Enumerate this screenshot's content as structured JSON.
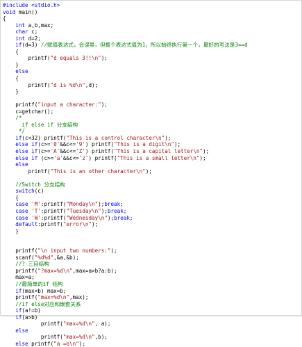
{
  "editor": {
    "lines": [
      [
        {
          "t": "#include <stdio.h>",
          "c": "pp"
        }
      ],
      [
        {
          "t": "void",
          "c": "kw"
        },
        {
          "t": " main()",
          "c": ""
        }
      ],
      [
        {
          "t": "{",
          "c": ""
        }
      ],
      [
        {
          "t": "    ",
          "c": ""
        },
        {
          "t": "int",
          "c": "kw"
        },
        {
          "t": " a,b,max;",
          "c": ""
        }
      ],
      [
        {
          "t": "    ",
          "c": ""
        },
        {
          "t": "char",
          "c": "kw"
        },
        {
          "t": " c;",
          "c": ""
        }
      ],
      [
        {
          "t": "    ",
          "c": ""
        },
        {
          "t": "int",
          "c": "kw"
        },
        {
          "t": " d=2;",
          "c": ""
        }
      ],
      [
        {
          "t": "    ",
          "c": ""
        },
        {
          "t": "if",
          "c": "kw"
        },
        {
          "t": "(d=3) ",
          "c": ""
        },
        {
          "t": "//赋值表达式，会误导，但整个表达式值为1，所以始终执行第一个，最好的写法是3==d",
          "c": "cm"
        }
      ],
      [
        {
          "t": "    {",
          "c": ""
        }
      ],
      [
        {
          "t": "        printf(",
          "c": ""
        },
        {
          "t": "\"d equals 3!!\\n\"",
          "c": "st"
        },
        {
          "t": ");",
          "c": ""
        }
      ],
      [
        {
          "t": "    }",
          "c": ""
        }
      ],
      [
        {
          "t": "    ",
          "c": ""
        },
        {
          "t": "else",
          "c": "kw"
        }
      ],
      [
        {
          "t": "    {",
          "c": ""
        }
      ],
      [
        {
          "t": "        printf(",
          "c": ""
        },
        {
          "t": "\"d is %d\\n\"",
          "c": "st"
        },
        {
          "t": ",d);",
          "c": ""
        }
      ],
      [
        {
          "t": "    }",
          "c": ""
        }
      ],
      [
        {
          "t": "",
          "c": ""
        }
      ],
      [
        {
          "t": "    printf(",
          "c": ""
        },
        {
          "t": "\"input a character:\"",
          "c": "st"
        },
        {
          "t": ");",
          "c": ""
        }
      ],
      [
        {
          "t": "    c=getchar();",
          "c": ""
        }
      ],
      [
        {
          "t": "    /*",
          "c": "cm"
        }
      ],
      [
        {
          "t": "      if else if 分支结构",
          "c": "cm"
        }
      ],
      [
        {
          "t": "     */",
          "c": "cm"
        }
      ],
      [
        {
          "t": "    ",
          "c": ""
        },
        {
          "t": "if",
          "c": "kw"
        },
        {
          "t": "(c<32) printf(",
          "c": ""
        },
        {
          "t": "\"This is a control character\\n\"",
          "c": "st"
        },
        {
          "t": ");",
          "c": ""
        }
      ],
      [
        {
          "t": "    ",
          "c": ""
        },
        {
          "t": "else if",
          "c": "kw"
        },
        {
          "t": "(c>=",
          "c": ""
        },
        {
          "t": "'0'",
          "c": "st"
        },
        {
          "t": "&&c<=",
          "c": ""
        },
        {
          "t": "'9'",
          "c": "st"
        },
        {
          "t": ") printf(",
          "c": ""
        },
        {
          "t": "\"This is a digit\\n\"",
          "c": "st"
        },
        {
          "t": ");",
          "c": ""
        }
      ],
      [
        {
          "t": "    ",
          "c": ""
        },
        {
          "t": "else if",
          "c": "kw"
        },
        {
          "t": "(c>=",
          "c": ""
        },
        {
          "t": "'A'",
          "c": "st"
        },
        {
          "t": "&&c<=",
          "c": ""
        },
        {
          "t": "'Z'",
          "c": "st"
        },
        {
          "t": ") printf(",
          "c": ""
        },
        {
          "t": "\"This is a capital letter\\n\"",
          "c": "st"
        },
        {
          "t": ");",
          "c": ""
        }
      ],
      [
        {
          "t": "    ",
          "c": ""
        },
        {
          "t": "else if",
          "c": "kw"
        },
        {
          "t": " (c>=",
          "c": ""
        },
        {
          "t": "'a'",
          "c": "st"
        },
        {
          "t": "&&c<=",
          "c": ""
        },
        {
          "t": "'z'",
          "c": "st"
        },
        {
          "t": ") printf(",
          "c": ""
        },
        {
          "t": "\"This is a small letter\\n\"",
          "c": "st"
        },
        {
          "t": ");",
          "c": ""
        }
      ],
      [
        {
          "t": "    ",
          "c": ""
        },
        {
          "t": "else",
          "c": "kw"
        }
      ],
      [
        {
          "t": "        printf(",
          "c": ""
        },
        {
          "t": "\"This is an other character\\n\"",
          "c": "st"
        },
        {
          "t": ");",
          "c": ""
        }
      ],
      [
        {
          "t": "",
          "c": ""
        }
      ],
      [
        {
          "t": "    //Switch 分支结构",
          "c": "cm"
        }
      ],
      [
        {
          "t": "    ",
          "c": ""
        },
        {
          "t": "switch",
          "c": "kw"
        },
        {
          "t": "(c)",
          "c": ""
        }
      ],
      [
        {
          "t": "    {",
          "c": ""
        }
      ],
      [
        {
          "t": "    ",
          "c": ""
        },
        {
          "t": "case",
          "c": "kw"
        },
        {
          "t": " ",
          "c": ""
        },
        {
          "t": "'M'",
          "c": "st"
        },
        {
          "t": ":printf(",
          "c": ""
        },
        {
          "t": "\"Monday\\n\"",
          "c": "st"
        },
        {
          "t": ");",
          "c": ""
        },
        {
          "t": "break",
          "c": "kw"
        },
        {
          "t": ";",
          "c": ""
        }
      ],
      [
        {
          "t": "    ",
          "c": ""
        },
        {
          "t": "case",
          "c": "kw"
        },
        {
          "t": " ",
          "c": ""
        },
        {
          "t": "'T'",
          "c": "st"
        },
        {
          "t": ":printf(",
          "c": ""
        },
        {
          "t": "\"Tuesday\\n\"",
          "c": "st"
        },
        {
          "t": ");",
          "c": ""
        },
        {
          "t": "break",
          "c": "kw"
        },
        {
          "t": ";",
          "c": ""
        }
      ],
      [
        {
          "t": "    ",
          "c": ""
        },
        {
          "t": "case",
          "c": "kw"
        },
        {
          "t": " ",
          "c": ""
        },
        {
          "t": "'W'",
          "c": "st"
        },
        {
          "t": ":printf(",
          "c": ""
        },
        {
          "t": "\"Wednesday\\n\"",
          "c": "st"
        },
        {
          "t": ");",
          "c": ""
        },
        {
          "t": "break",
          "c": "kw"
        },
        {
          "t": ";",
          "c": ""
        }
      ],
      [
        {
          "t": "    ",
          "c": ""
        },
        {
          "t": "default",
          "c": "kw"
        },
        {
          "t": ":printf(",
          "c": ""
        },
        {
          "t": "\"error\\n\"",
          "c": "st"
        },
        {
          "t": ");",
          "c": ""
        }
      ],
      [
        {
          "t": "    }",
          "c": ""
        }
      ],
      [
        {
          "t": "",
          "c": ""
        }
      ],
      [
        {
          "t": "",
          "c": ""
        }
      ],
      [
        {
          "t": "    printf(",
          "c": ""
        },
        {
          "t": "\"\\n input two numbers:\"",
          "c": "st"
        },
        {
          "t": ");",
          "c": ""
        }
      ],
      [
        {
          "t": "    scanf(",
          "c": ""
        },
        {
          "t": "\"%d%d\"",
          "c": "st"
        },
        {
          "t": ",&a,&b);",
          "c": ""
        }
      ],
      [
        {
          "t": "    //? 三目结构",
          "c": "cm"
        }
      ],
      [
        {
          "t": "    printf(",
          "c": ""
        },
        {
          "t": "\"?max=%d\\n\"",
          "c": "st"
        },
        {
          "t": ",max=a>b?a:b);",
          "c": ""
        }
      ],
      [
        {
          "t": "    max=a;",
          "c": ""
        }
      ],
      [
        {
          "t": "    //最简单的if 结构",
          "c": "cm"
        }
      ],
      [
        {
          "t": "    ",
          "c": ""
        },
        {
          "t": "if",
          "c": "kw"
        },
        {
          "t": "(max<b) max=b;",
          "c": ""
        }
      ],
      [
        {
          "t": "    printf(",
          "c": ""
        },
        {
          "t": "\"max=%d\\n\"",
          "c": "st"
        },
        {
          "t": ",max);",
          "c": ""
        }
      ],
      [
        {
          "t": "    //if else对应和嵌套关系",
          "c": "cm"
        }
      ],
      [
        {
          "t": "    ",
          "c": ""
        },
        {
          "t": "if",
          "c": "kw"
        },
        {
          "t": "(a!=b)",
          "c": ""
        }
      ],
      [
        {
          "t": "    ",
          "c": ""
        },
        {
          "t": "if",
          "c": "kw"
        },
        {
          "t": "(a>b)",
          "c": ""
        }
      ],
      [
        {
          "t": "            printf(",
          "c": ""
        },
        {
          "t": "\"max=%d\\n\"",
          "c": "st"
        },
        {
          "t": ", a);",
          "c": ""
        }
      ],
      [
        {
          "t": "    ",
          "c": ""
        },
        {
          "t": "else",
          "c": "kw"
        }
      ],
      [
        {
          "t": "            printf(",
          "c": ""
        },
        {
          "t": "\"max=%d\\n\"",
          "c": "st"
        },
        {
          "t": ",b);",
          "c": ""
        }
      ],
      [
        {
          "t": "    ",
          "c": ""
        },
        {
          "t": "else",
          "c": "kw"
        },
        {
          "t": " printf(",
          "c": ""
        },
        {
          "t": "\"a =b\\n\"",
          "c": "st"
        },
        {
          "t": ");",
          "c": ""
        }
      ]
    ]
  },
  "colors": {
    "keyword": "#0000ff",
    "comment": "#008000",
    "string": "#a31515",
    "text": "#000000",
    "background": "#ffffff"
  }
}
